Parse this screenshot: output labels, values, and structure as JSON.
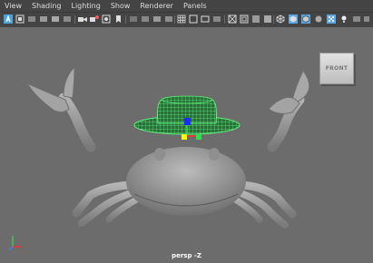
{
  "menus": [
    "View",
    "Shading",
    "Lighting",
    "Show",
    "Renderer",
    "Panels"
  ],
  "viewcube": {
    "face_label": "FRONT"
  },
  "camera": {
    "name": "persp -Z"
  },
  "colors": {
    "hat_wireframe": "#5ff07a",
    "manipulator_x": "#ff2b2b",
    "manipulator_y": "#2ee04a",
    "manipulator_z": "#1a2bff",
    "manipulator_center": "#ffff00",
    "toolbar_active": "#5aa9e6"
  },
  "toolbar_icons": [
    "select-camera-icon",
    "camera-attributes-icon",
    "bookmark-icon",
    "image-plane-icon",
    "2d-pan-zoom-icon",
    "grease-pencil-icon",
    "grid-icon",
    "film-gate-icon",
    "resolution-gate-icon",
    "gate-mask-icon",
    "field-chart-icon",
    "safe-action-icon",
    "safe-title-icon",
    "wireframe-icon",
    "smooth-shade-icon",
    "default-material-icon",
    "textured-icon",
    "use-all-lights-icon",
    "shadows-icon"
  ]
}
